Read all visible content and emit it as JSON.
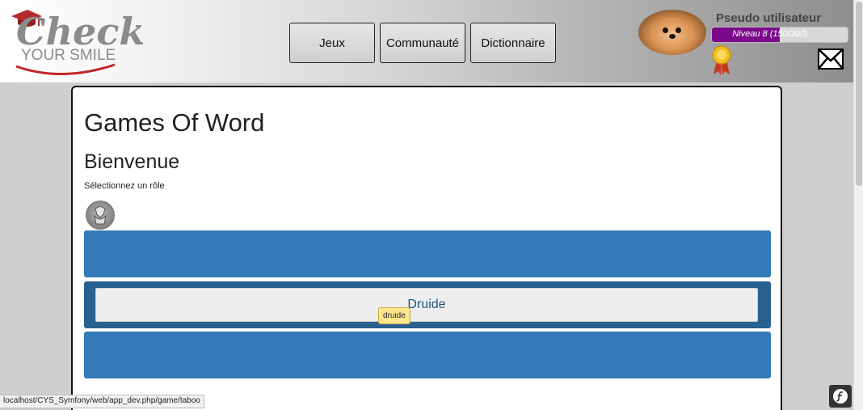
{
  "header": {
    "logo": {
      "line1": "Check",
      "line2": "YOUR SMILE"
    },
    "nav": [
      {
        "label": "Jeux"
      },
      {
        "label": "Communauté"
      },
      {
        "label": "Dictionnaire"
      }
    ],
    "user": {
      "name": "Pseudo utilisateur",
      "level_text": "Niveau 8 (150/300)",
      "level_progress": 0.5
    }
  },
  "main": {
    "title": "Games Of Word",
    "subtitle": "Bienvenue",
    "instruction": "Sélectionnez un rôle",
    "roles": [
      {
        "label": ""
      },
      {
        "label": "Druide"
      },
      {
        "label": ""
      }
    ],
    "tooltip": "druide"
  },
  "status": {
    "url": "localhost/CYS_Symfony/web/app_dev.php/game/taboo"
  },
  "colors": {
    "role_row": "#337ab7",
    "role_row_active": "#286090",
    "level_fill": "#7a0a8a"
  },
  "icons": [
    "graduation-cap-icon",
    "avatar-dog",
    "medal-icon",
    "mail-icon",
    "druid-role-icon",
    "symfony-icon"
  ]
}
